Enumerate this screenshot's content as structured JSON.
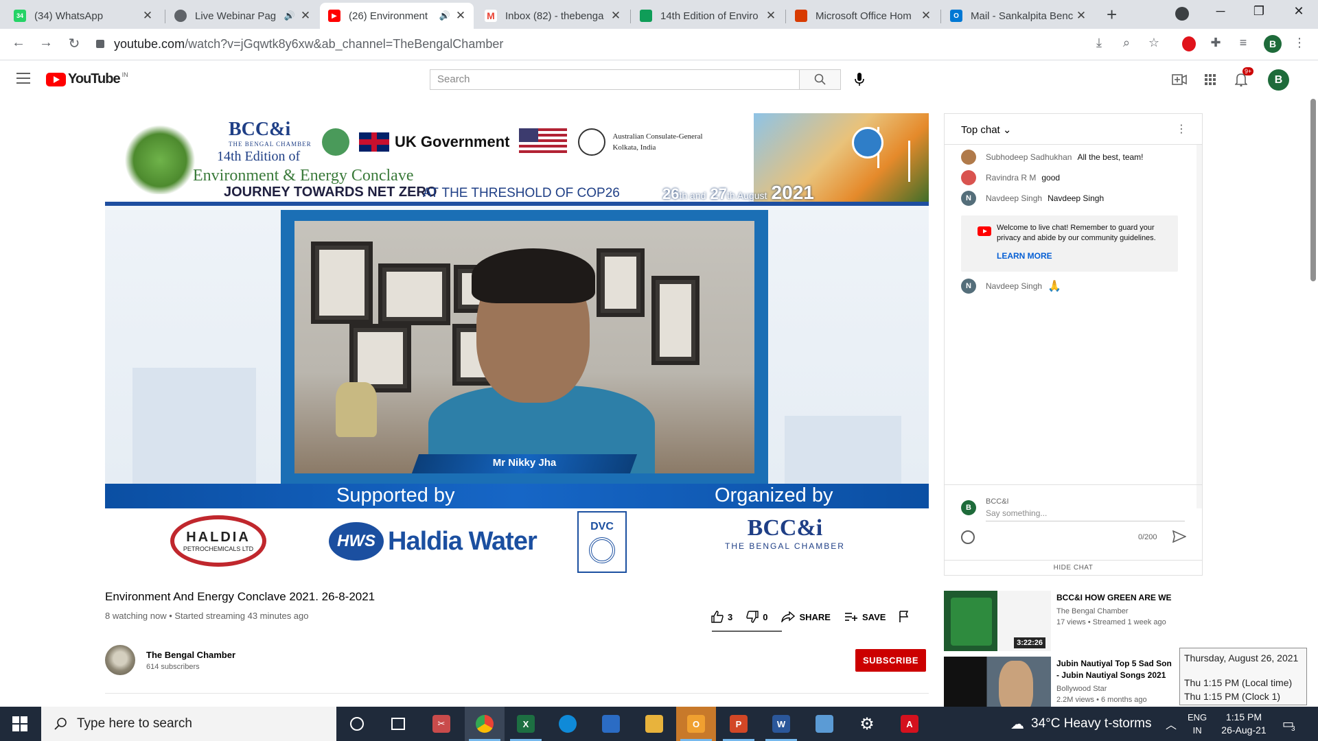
{
  "browser": {
    "tabs": [
      {
        "title": "(34) WhatsApp",
        "favicon": "whatsapp-icon",
        "color": "#25d366",
        "badge": "34",
        "audio": false
      },
      {
        "title": "Live Webinar Pag",
        "favicon": "globe-icon",
        "color": "#5f6368",
        "badge": "",
        "audio": true
      },
      {
        "title": "(26) Environment",
        "favicon": "youtube-icon",
        "color": "#ff0000",
        "badge": "",
        "audio": true,
        "active": true
      },
      {
        "title": "Inbox (82) - thebenga",
        "favicon": "gmail-icon",
        "color": "#ea4335",
        "badge": "",
        "audio": false
      },
      {
        "title": "14th Edition of Enviro",
        "favicon": "sheets-icon",
        "color": "#0f9d58",
        "badge": "",
        "audio": false
      },
      {
        "title": "Microsoft Office Hom",
        "favicon": "office-icon",
        "color": "#d83b01",
        "badge": "",
        "audio": false
      },
      {
        "title": "Mail - Sankalpita Benc",
        "favicon": "outlook-icon",
        "color": "#0078d4",
        "badge": "",
        "audio": false
      }
    ],
    "url_host": "youtube.com",
    "url_path": "/watch?v=jGqwtk8y6xw&ab_channel=TheBengalChamber",
    "profile_initial": "B"
  },
  "youtube": {
    "logo_text": "YouTube",
    "country_code": "IN",
    "search_placeholder": "Search",
    "notification_count": "9+",
    "avatar_initial": "B"
  },
  "video": {
    "banner": {
      "org_logo": "BCC&i",
      "org_sub": "THE BENGAL CHAMBER",
      "edition": "14th Edition of",
      "event": "Environment & Energy Conclave",
      "tagline": "JOURNEY TOWARDS NET ZERO",
      "subtagline": "AT THE THRESHOLD OF COP26",
      "date_26": "26",
      "date_th1": "th and",
      "date_27": "27",
      "date_th2": "th August",
      "year": "2021",
      "sponsor_uk": "UK Government",
      "sponsor_aus_line1": "Australian Consulate-General",
      "sponsor_aus_line2": "Kolkata, India"
    },
    "speaker_name": "Mr Nikky Jha",
    "supported_by": "Supported by",
    "organized_by": "Organized by",
    "logo_haldia": "HALDIA",
    "logo_haldia_sub": "PETROCHEMICALS LTD",
    "logo_hws_badge": "HWS",
    "logo_hws_text": "Haldia Water",
    "logo_dvc": "DVC",
    "logo_bcc": "BCC&i",
    "logo_bcc_sub": "THE BENGAL CHAMBER",
    "title": "Environment And Energy Conclave 2021. 26-8-2021",
    "meta": "8 watching now • Started streaming 43 minutes ago",
    "likes": "3",
    "dislikes": "0",
    "share_label": "SHARE",
    "save_label": "SAVE"
  },
  "channel": {
    "name": "The Bengal Chamber",
    "subscribers": "614 subscribers",
    "subscribe_label": "SUBSCRIBE"
  },
  "chat": {
    "header": "Top chat",
    "messages": [
      {
        "author": "Subhodeep Sadhukhan",
        "text": "All the best, team!",
        "avatar_color": "#b07a4a",
        "initial": ""
      },
      {
        "author": "Ravindra R M",
        "text": "good",
        "avatar_color": "#d9534f",
        "initial": ""
      },
      {
        "author": "Navdeep Singh",
        "text": "Navdeep Singh",
        "avatar_color": "#546e7a",
        "initial": "N"
      },
      {
        "author": "Navdeep Singh",
        "text": "🙏",
        "avatar_color": "#546e7a",
        "initial": "N"
      }
    ],
    "welcome_text": "Welcome to live chat! Remember to guard your privacy and abide by our community guidelines.",
    "learn_more": "LEARN MORE",
    "input_user": "BCC&I",
    "input_placeholder": "Say something...",
    "input_initial": "B",
    "char_count": "0/200",
    "hide_chat": "HIDE CHAT"
  },
  "recommendations": [
    {
      "title": "BCC&I HOW GREEN ARE WE",
      "channel": "The Bengal Chamber",
      "meta": "17 views • Streamed 1 week ago",
      "duration": "3:22:26"
    },
    {
      "title": "Jubin Nautiyal Top 5 Sad Son",
      "title2": "- Jubin Nautiyal Songs 2021",
      "channel": "Bollywood Star",
      "meta": "2.2M views • 6 months ago",
      "duration": ""
    }
  ],
  "clock_tooltip": {
    "date": "Thursday, August 26, 2021",
    "local": "Thu 1:15 PM  (Local time)",
    "clock1": "Thu 1:15 PM  (Clock 1)"
  },
  "taskbar": {
    "search_placeholder": "Type here to search",
    "weather": "34°C  Heavy t-storms",
    "lang1": "ENG",
    "lang2": "IN",
    "time": "1:15 PM",
    "date": "26-Aug-21",
    "notif_count": "3"
  }
}
